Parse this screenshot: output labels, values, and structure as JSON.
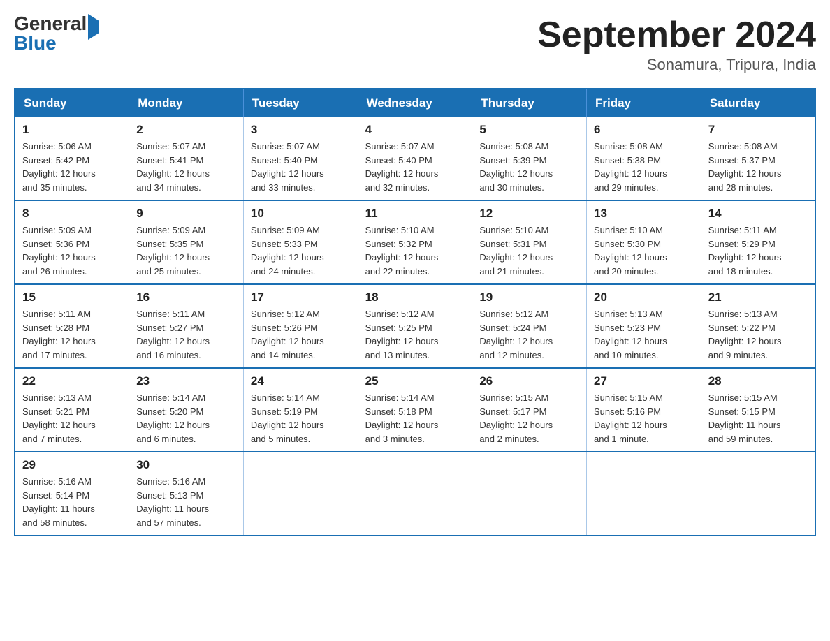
{
  "header": {
    "logo_general": "General",
    "logo_blue": "Blue",
    "title": "September 2024",
    "subtitle": "Sonamura, Tripura, India"
  },
  "days_of_week": [
    "Sunday",
    "Monday",
    "Tuesday",
    "Wednesday",
    "Thursday",
    "Friday",
    "Saturday"
  ],
  "weeks": [
    [
      {
        "day": "1",
        "sunrise": "5:06 AM",
        "sunset": "5:42 PM",
        "daylight": "12 hours and 35 minutes."
      },
      {
        "day": "2",
        "sunrise": "5:07 AM",
        "sunset": "5:41 PM",
        "daylight": "12 hours and 34 minutes."
      },
      {
        "day": "3",
        "sunrise": "5:07 AM",
        "sunset": "5:40 PM",
        "daylight": "12 hours and 33 minutes."
      },
      {
        "day": "4",
        "sunrise": "5:07 AM",
        "sunset": "5:40 PM",
        "daylight": "12 hours and 32 minutes."
      },
      {
        "day": "5",
        "sunrise": "5:08 AM",
        "sunset": "5:39 PM",
        "daylight": "12 hours and 30 minutes."
      },
      {
        "day": "6",
        "sunrise": "5:08 AM",
        "sunset": "5:38 PM",
        "daylight": "12 hours and 29 minutes."
      },
      {
        "day": "7",
        "sunrise": "5:08 AM",
        "sunset": "5:37 PM",
        "daylight": "12 hours and 28 minutes."
      }
    ],
    [
      {
        "day": "8",
        "sunrise": "5:09 AM",
        "sunset": "5:36 PM",
        "daylight": "12 hours and 26 minutes."
      },
      {
        "day": "9",
        "sunrise": "5:09 AM",
        "sunset": "5:35 PM",
        "daylight": "12 hours and 25 minutes."
      },
      {
        "day": "10",
        "sunrise": "5:09 AM",
        "sunset": "5:33 PM",
        "daylight": "12 hours and 24 minutes."
      },
      {
        "day": "11",
        "sunrise": "5:10 AM",
        "sunset": "5:32 PM",
        "daylight": "12 hours and 22 minutes."
      },
      {
        "day": "12",
        "sunrise": "5:10 AM",
        "sunset": "5:31 PM",
        "daylight": "12 hours and 21 minutes."
      },
      {
        "day": "13",
        "sunrise": "5:10 AM",
        "sunset": "5:30 PM",
        "daylight": "12 hours and 20 minutes."
      },
      {
        "day": "14",
        "sunrise": "5:11 AM",
        "sunset": "5:29 PM",
        "daylight": "12 hours and 18 minutes."
      }
    ],
    [
      {
        "day": "15",
        "sunrise": "5:11 AM",
        "sunset": "5:28 PM",
        "daylight": "12 hours and 17 minutes."
      },
      {
        "day": "16",
        "sunrise": "5:11 AM",
        "sunset": "5:27 PM",
        "daylight": "12 hours and 16 minutes."
      },
      {
        "day": "17",
        "sunrise": "5:12 AM",
        "sunset": "5:26 PM",
        "daylight": "12 hours and 14 minutes."
      },
      {
        "day": "18",
        "sunrise": "5:12 AM",
        "sunset": "5:25 PM",
        "daylight": "12 hours and 13 minutes."
      },
      {
        "day": "19",
        "sunrise": "5:12 AM",
        "sunset": "5:24 PM",
        "daylight": "12 hours and 12 minutes."
      },
      {
        "day": "20",
        "sunrise": "5:13 AM",
        "sunset": "5:23 PM",
        "daylight": "12 hours and 10 minutes."
      },
      {
        "day": "21",
        "sunrise": "5:13 AM",
        "sunset": "5:22 PM",
        "daylight": "12 hours and 9 minutes."
      }
    ],
    [
      {
        "day": "22",
        "sunrise": "5:13 AM",
        "sunset": "5:21 PM",
        "daylight": "12 hours and 7 minutes."
      },
      {
        "day": "23",
        "sunrise": "5:14 AM",
        "sunset": "5:20 PM",
        "daylight": "12 hours and 6 minutes."
      },
      {
        "day": "24",
        "sunrise": "5:14 AM",
        "sunset": "5:19 PM",
        "daylight": "12 hours and 5 minutes."
      },
      {
        "day": "25",
        "sunrise": "5:14 AM",
        "sunset": "5:18 PM",
        "daylight": "12 hours and 3 minutes."
      },
      {
        "day": "26",
        "sunrise": "5:15 AM",
        "sunset": "5:17 PM",
        "daylight": "12 hours and 2 minutes."
      },
      {
        "day": "27",
        "sunrise": "5:15 AM",
        "sunset": "5:16 PM",
        "daylight": "12 hours and 1 minute."
      },
      {
        "day": "28",
        "sunrise": "5:15 AM",
        "sunset": "5:15 PM",
        "daylight": "11 hours and 59 minutes."
      }
    ],
    [
      {
        "day": "29",
        "sunrise": "5:16 AM",
        "sunset": "5:14 PM",
        "daylight": "11 hours and 58 minutes."
      },
      {
        "day": "30",
        "sunrise": "5:16 AM",
        "sunset": "5:13 PM",
        "daylight": "11 hours and 57 minutes."
      },
      null,
      null,
      null,
      null,
      null
    ]
  ],
  "labels": {
    "sunrise": "Sunrise:",
    "sunset": "Sunset:",
    "daylight": "Daylight:"
  }
}
